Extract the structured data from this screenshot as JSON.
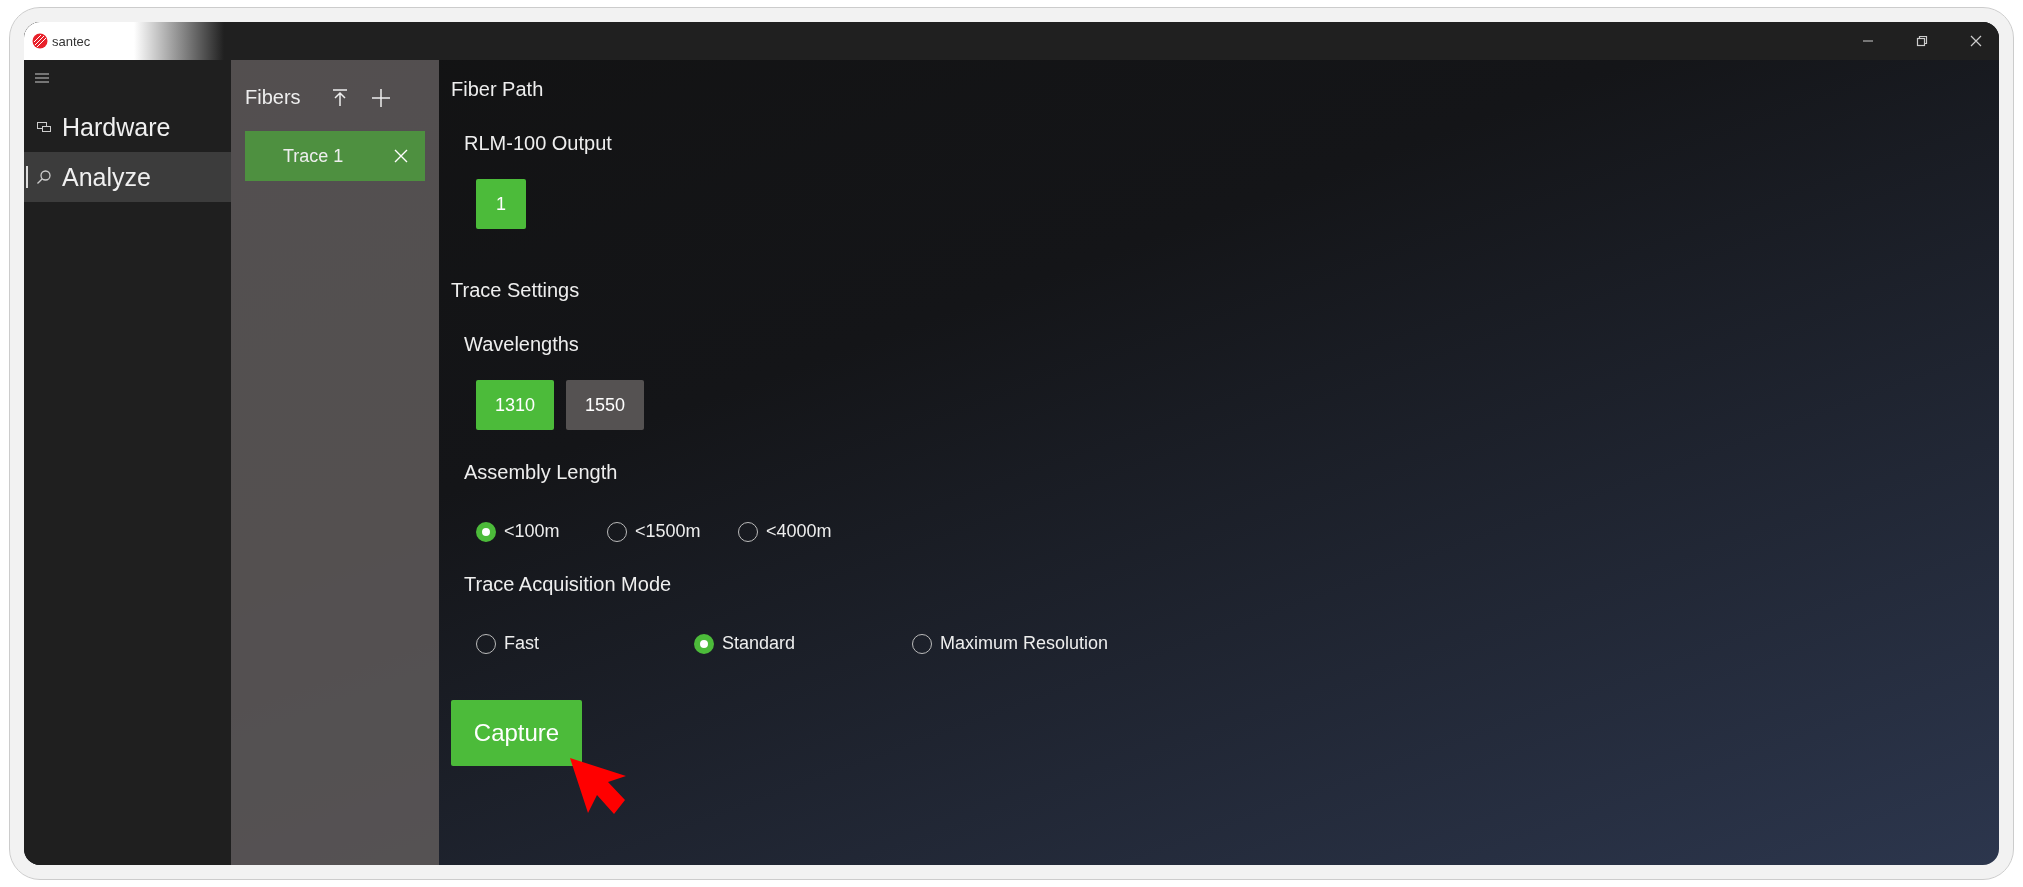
{
  "app": {
    "logo_text": "santec"
  },
  "nav": [
    {
      "label": "Hardware",
      "selected": false
    },
    {
      "label": "Analyze",
      "selected": true
    }
  ],
  "fibers": {
    "title": "Fibers",
    "items": [
      {
        "label": "Trace 1",
        "selected": true
      }
    ]
  },
  "main": {
    "fiber_path": {
      "title": "Fiber Path",
      "output_label": "RLM-100 Output",
      "outputs": [
        {
          "label": "1",
          "selected": true
        }
      ]
    },
    "trace_settings": {
      "title": "Trace Settings",
      "wavelengths": {
        "label": "Wavelengths",
        "options": [
          {
            "label": "1310",
            "selected": true
          },
          {
            "label": "1550",
            "selected": false
          }
        ]
      },
      "assembly_length": {
        "label": "Assembly Length",
        "options": [
          {
            "label": "<100m",
            "selected": true
          },
          {
            "label": "<1500m",
            "selected": false
          },
          {
            "label": "<4000m",
            "selected": false
          }
        ]
      },
      "acquisition_mode": {
        "label": "Trace Acquisition Mode",
        "options": [
          {
            "label": "Fast",
            "selected": false
          },
          {
            "label": "Standard",
            "selected": true
          },
          {
            "label": "Maximum Resolution",
            "selected": false
          }
        ]
      }
    },
    "capture_button": "Capture"
  }
}
